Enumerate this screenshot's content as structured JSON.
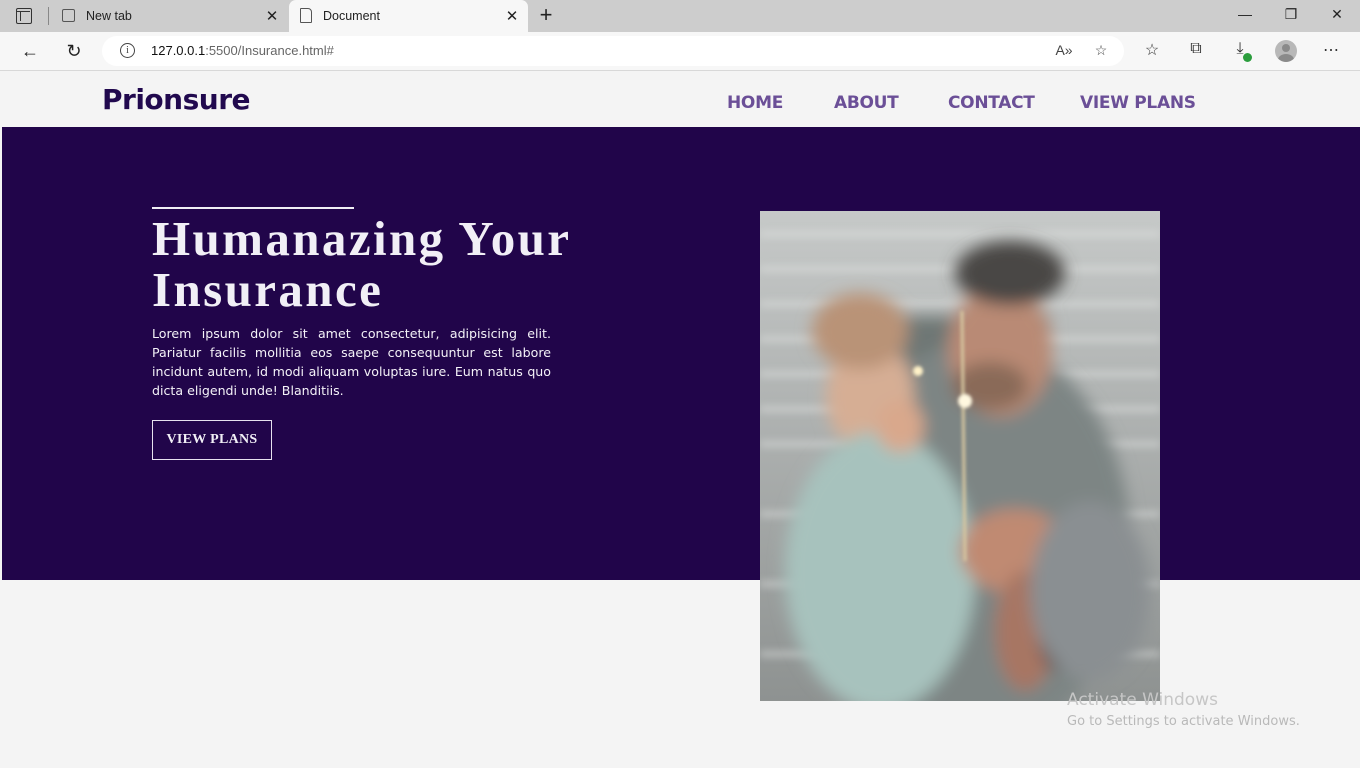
{
  "browser": {
    "tabs": [
      {
        "label": "New tab",
        "active": false
      },
      {
        "label": "Document",
        "active": true
      }
    ],
    "url_host": "127.0.0.1",
    "url_rest": ":5500/Insurance.html#",
    "icons": {
      "tab_actions": "tab-actions-icon",
      "back": "back-arrow-icon",
      "refresh": "refresh-icon",
      "site_info": "info-icon",
      "read_aloud": "read-aloud-icon",
      "add_favorite": "star-add-icon",
      "favorites": "favorites-icon",
      "collections": "collections-icon",
      "downloads": "download-icon",
      "profile": "avatar",
      "menu": "more-dots-icon"
    }
  },
  "site": {
    "logo": "Prionsure",
    "nav": [
      "HOME",
      "ABOUT",
      "CONTACT",
      "VIEW PLANS"
    ],
    "colors": {
      "brand": "#21094e",
      "nav": "#6b4f97",
      "hero_bg": "#21054a",
      "page_bg": "#f4f4f4"
    }
  },
  "hero": {
    "title_line1": "Humanazing Your",
    "title_line2": "Insurance",
    "text": "Lorem ipsum dolor sit amet consectetur, adipisicing elit. Pariatur facilis mollitia eos saepe consequuntur est labore incidunt autem, id modi aliquam voluptas iure. Eum natus quo dicta eligendi unde! Blanditiis.",
    "button": "VIEW PLANS",
    "image_alt": "father-and-daughter-with-sparkler-photo"
  },
  "watermark": {
    "line1": "Activate Windows",
    "line2": "Go to Settings to activate Windows."
  }
}
